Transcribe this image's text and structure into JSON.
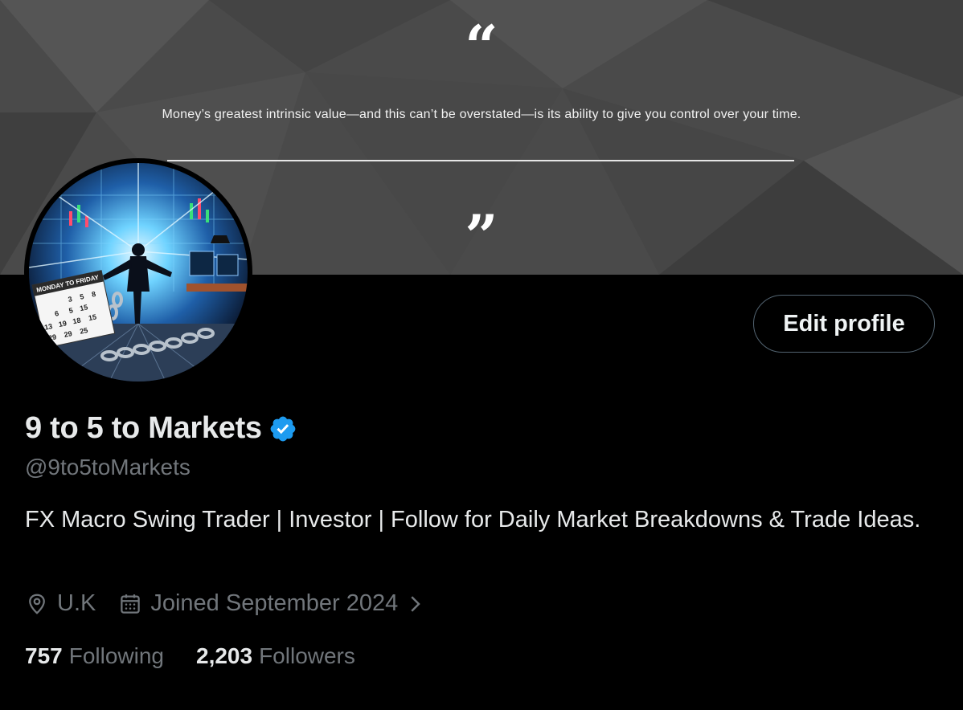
{
  "banner": {
    "quote_open": "“",
    "quote_text": "Money’s greatest intrinsic value—and this can’t be overstated—is its ability to give you control over your time.",
    "quote_close": "”",
    "background_color": "#4d4d4d"
  },
  "avatar": {
    "calendar_label": "MONDAY TO FRIDAY",
    "calendar_numbers": [
      "3",
      "5",
      "8",
      "6",
      "5",
      "15",
      "13",
      "19",
      "18",
      "15",
      "29",
      "29",
      "25"
    ]
  },
  "actions": {
    "edit_profile_label": "Edit profile"
  },
  "profile": {
    "display_name": "9 to 5 to Markets",
    "verified_icon": "verified-badge-icon",
    "handle": "@9to5toMarkets",
    "bio": "FX Macro Swing Trader | Investor | Follow for Daily Market Breakdowns & Trade Ideas.",
    "location": "U.K",
    "joined": "Joined September 2024",
    "accent_color": "#1d9bf0"
  },
  "stats": {
    "following_count": "757",
    "following_label": "Following",
    "followers_count": "2,203",
    "followers_label": "Followers"
  }
}
